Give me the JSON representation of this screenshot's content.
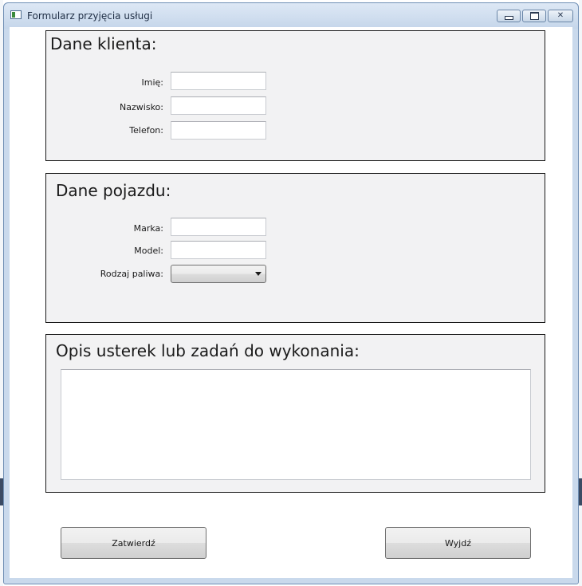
{
  "window": {
    "title": "Formularz przyjęcia usługi",
    "icon": "window-app-icon",
    "controls": [
      "minimize-icon",
      "maximize-icon",
      "close-icon"
    ],
    "close_glyph": "✕"
  },
  "client_group": {
    "title": "Dane klienta:",
    "fields": [
      {
        "label": "Imię:",
        "value": ""
      },
      {
        "label": "Nazwisko:",
        "value": ""
      },
      {
        "label": "Telefon:",
        "value": ""
      }
    ]
  },
  "vehicle_group": {
    "title": "Dane pojazdu:",
    "fields": [
      {
        "label": "Marka:",
        "value": ""
      },
      {
        "label": "Model:",
        "value": ""
      }
    ],
    "fuel": {
      "label": "Rodzaj paliwa:",
      "selected": ""
    }
  },
  "description_group": {
    "title": "Opis usterek lub zadań do wykonania:",
    "value": ""
  },
  "buttons": {
    "submit": "Zatwierdź",
    "exit": "Wyjdź"
  },
  "colors": {
    "group_background": "#f2f2f3",
    "group_border": "#1a1a1a",
    "window_frame": "#c9d9ec"
  }
}
